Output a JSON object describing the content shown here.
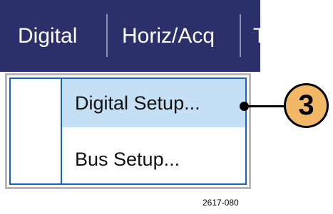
{
  "menubar": {
    "items": [
      {
        "label": "Digital"
      },
      {
        "label": "Horiz/Acq"
      },
      {
        "label": "T"
      }
    ]
  },
  "dropdown": {
    "items": [
      {
        "label": "Digital Setup...",
        "selected": true
      },
      {
        "label": "Bus Setup...",
        "selected": false
      }
    ]
  },
  "callout": {
    "number": "3"
  },
  "figure_id": "2617-080",
  "colors": {
    "menubar_bg": "#2b2f6a",
    "menu_text": "#ffffff",
    "selected_bg": "#c5dff5",
    "dropdown_border": "#1565c0",
    "callout_fill": "#f2b866"
  }
}
